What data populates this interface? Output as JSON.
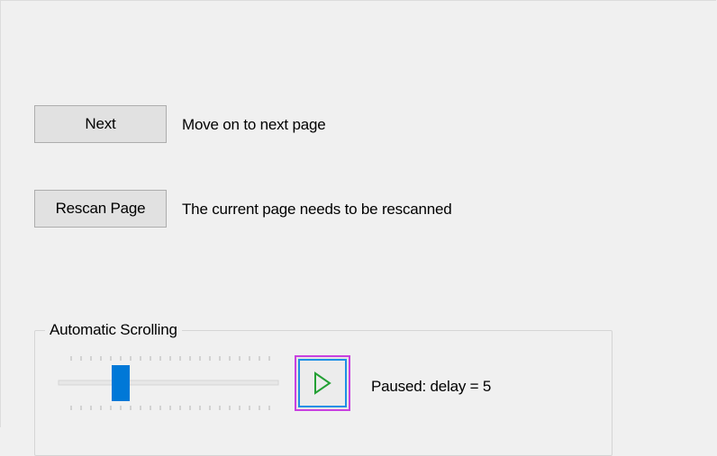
{
  "actions": [
    {
      "button_label": "Next",
      "description": "Move on to next page"
    },
    {
      "button_label": "Rescan Page",
      "description": "The current page needs to be rescanned"
    }
  ],
  "auto_scroll": {
    "group_label": "Automatic Scrolling",
    "slider": {
      "value": 5,
      "min": 0,
      "max": 20,
      "thumb_color": "#0078d7"
    },
    "play_icon": "play-icon",
    "play_color": "#23a034",
    "status_text": "Paused: delay = 5"
  },
  "colors": {
    "button_face": "#e1e1e1",
    "button_border": "#adadad",
    "focus_outer": "#c840e0",
    "focus_inner": "#1e90e6"
  }
}
